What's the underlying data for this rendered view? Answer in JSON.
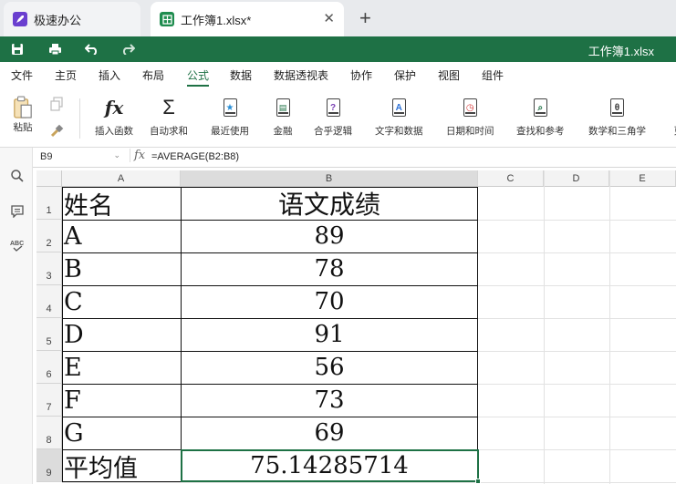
{
  "tabs": [
    {
      "label": "极速办公",
      "icon": "rocket-icon"
    },
    {
      "label": "工作簿1.xlsx*",
      "icon": "spreadsheet-icon",
      "active": true
    }
  ],
  "newtab_label": "+",
  "doc_title": "工作簿1.xlsx",
  "menu": [
    "文件",
    "主页",
    "插入",
    "布局",
    "公式",
    "数据",
    "数据透视表",
    "协作",
    "保护",
    "视图",
    "组件"
  ],
  "menu_active": "公式",
  "ribbon": {
    "paste": "粘贴",
    "insert_function": "插入函数",
    "autosum": "自动求和",
    "recent": "最近使用",
    "financial": "金融",
    "logical": "合乎逻辑",
    "text_data": "文字和数据",
    "date_time": "日期和时间",
    "lookup": "查找和参考",
    "math_trig": "数学和三角学",
    "more": "更"
  },
  "formula_bar": {
    "name_box": "B9",
    "fx": "fx",
    "formula": "=AVERAGE(B2:B8)"
  },
  "columns": [
    "A",
    "B",
    "C",
    "D",
    "E"
  ],
  "rows": [
    "1",
    "2",
    "3",
    "4",
    "5",
    "6",
    "7",
    "8",
    "9"
  ],
  "cells": {
    "A": [
      "姓名",
      "A",
      "B",
      "C",
      "D",
      "E",
      "F",
      "G",
      "平均值"
    ],
    "B": [
      "语文成绩",
      "89",
      "78",
      "70",
      "91",
      "56",
      "73",
      "69",
      "75.14285714"
    ]
  },
  "selected_cell": "B9",
  "colors": {
    "accent": "#1e7145",
    "tab_bar": "#e8eaed"
  }
}
